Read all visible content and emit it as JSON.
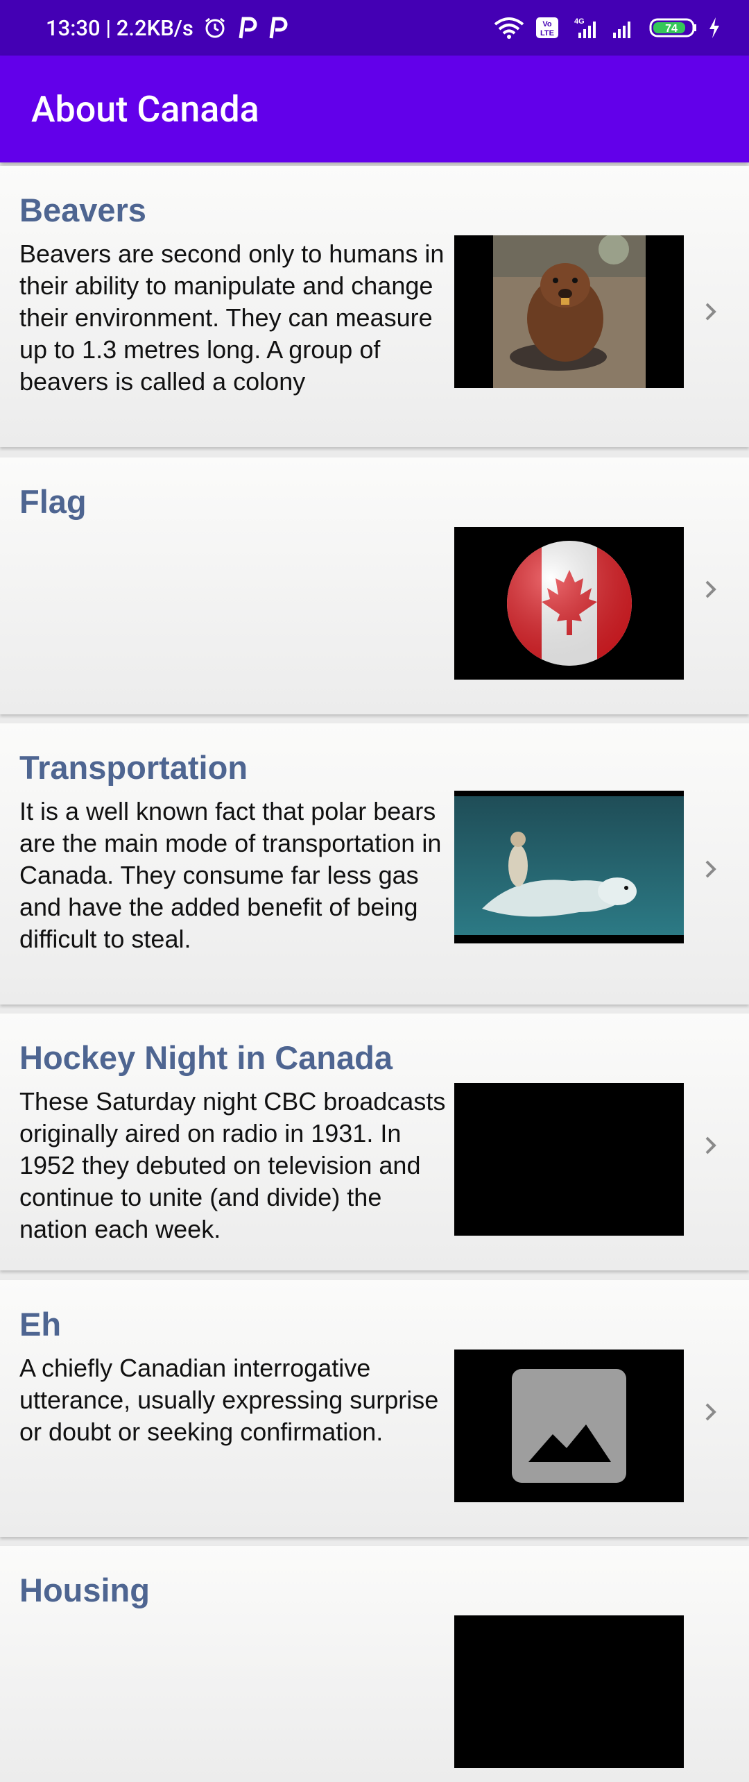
{
  "status_bar": {
    "time_speed": "13:30 | 2.2KB/s",
    "battery_level": "74",
    "icons": [
      "alarm-icon",
      "p-app-icon",
      "p-app-icon",
      "wifi-icon",
      "volte-icon",
      "4g-signal-icon",
      "signal-icon",
      "battery-icon",
      "charging-icon"
    ]
  },
  "app_bar": {
    "title": "About Canada"
  },
  "items": [
    {
      "title": "Beavers",
      "description": "Beavers are second only to humans in their ability to manipulate and change their environment. They can measure up to 1.3 metres long. A group of beavers is called a colony",
      "image": "beaver-photo"
    },
    {
      "title": "Flag",
      "description": "",
      "image": "canada-flag-image"
    },
    {
      "title": "Transportation",
      "description": "It is a well known fact that polar bears are the main mode of transportation in Canada. They consume far less gas and have the added benefit of being difficult to steal.",
      "image": "polar-bear-photo"
    },
    {
      "title": "Hockey Night in Canada",
      "description": "These Saturday night CBC broadcasts originally aired on radio in 1931. In 1952 they debuted on television and continue to unite (and divide) the nation each week.",
      "image": "black-image"
    },
    {
      "title": "Eh",
      "description": "A chiefly Canadian interrogative utterance, usually expressing surprise or doubt or seeking confirmation.",
      "image": "image-placeholder-icon"
    },
    {
      "title": "Housing",
      "description": "",
      "image": "black-image"
    }
  ]
}
